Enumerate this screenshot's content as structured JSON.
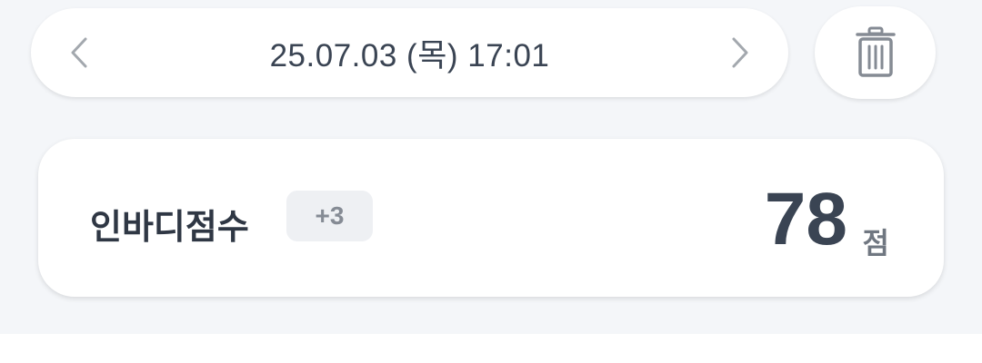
{
  "date_nav": {
    "date_text": "25.07.03 (목) 17:01",
    "prev_icon": "chevron-left-icon",
    "next_icon": "chevron-right-icon"
  },
  "delete_button": {
    "icon": "trash-icon"
  },
  "score_card": {
    "label": "인바디점수",
    "delta": "+3",
    "value": "78",
    "unit": "점"
  },
  "colors": {
    "background": "#f4f6f9",
    "card": "#ffffff",
    "text_primary": "#3a4453",
    "badge_bg": "#eef0f3",
    "badge_text": "#858b94",
    "icon_gray": "#a3a8ae"
  }
}
